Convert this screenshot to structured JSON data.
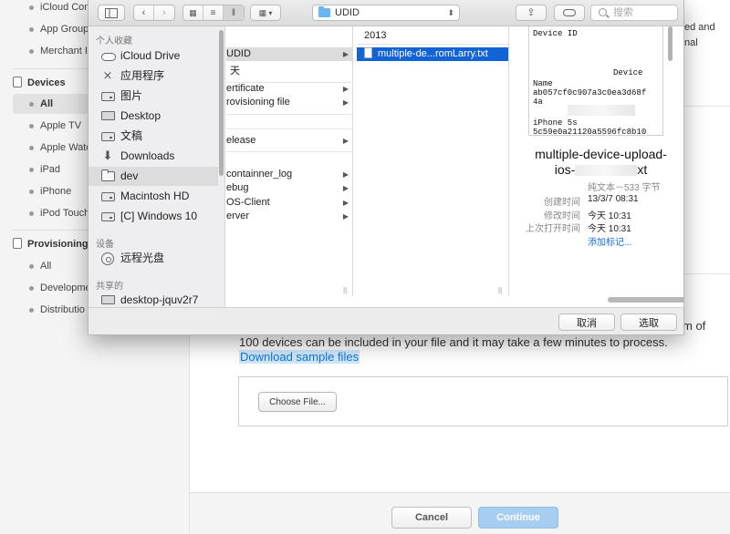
{
  "background": {
    "sidebar": {
      "top_item": "iCloud Con",
      "items_upper": [
        "App Group",
        "Merchant I"
      ],
      "devices_header": "Devices",
      "devices_items": [
        "All",
        "Apple TV",
        "Apple Watc",
        "iPad",
        "iPhone",
        "iPod Touch"
      ],
      "provisioning_header": "Provisioning",
      "provisioning_items": [
        "All",
        "Developme",
        "Distributio"
      ]
    },
    "main": {
      "top_right_lines": [
        "ed and",
        "nal"
      ],
      "paragraph_tail": "m of",
      "paragraph_line": "100 devices can be included in your file and it may take a few minutes to process.",
      "download_link": "Download sample files",
      "choose_file_label": "Choose File...",
      "cancel_label": "Cancel",
      "continue_label": "Continue"
    }
  },
  "dialog": {
    "toolbar": {
      "path_folder": "UDID",
      "search_placeholder": "搜索"
    },
    "sidebar": {
      "favorites_header": "个人收藏",
      "favorites": [
        "iCloud Drive",
        "应用程序",
        "图片",
        "Desktop",
        "文稿",
        "Downloads",
        "dev",
        "Macintosh HD",
        "[C] Windows 10"
      ],
      "devices_header": "设备",
      "devices": [
        "远程光盘"
      ],
      "shared_header": "共享的",
      "shared": [
        "desktop-jquv2r7"
      ]
    },
    "column1": {
      "rows": [
        "UDID",
        "天",
        "ertificate",
        "rovisioning file",
        "elease",
        "containner_log",
        "ebug",
        "OS-Client",
        "erver"
      ]
    },
    "column2": {
      "header": "2013",
      "selected_file": "multiple-de...romLarry.txt"
    },
    "preview": {
      "doc_lines": [
        "Device ID",
        "Device",
        "Name",
        "ab057cf0c907a3c0ea3d68f",
        "4a",
        "iPhone 5s",
        "5c59e0a21120a5596fc8b10"
      ],
      "name_line1": "multiple-device-upload-",
      "name_line2_start": "ios-",
      "name_line2_end": "xt",
      "kind": "纯文本－533 字节",
      "meta": [
        {
          "key": "创建时间",
          "value": "13/3/7 08:31"
        },
        {
          "key": "修改时间",
          "value": "今天 10:31"
        },
        {
          "key": "上次打开时间",
          "value": "今天 10:31"
        }
      ],
      "add_tags": "添加标记..."
    },
    "buttons": {
      "cancel": "取消",
      "choose": "选取"
    }
  }
}
